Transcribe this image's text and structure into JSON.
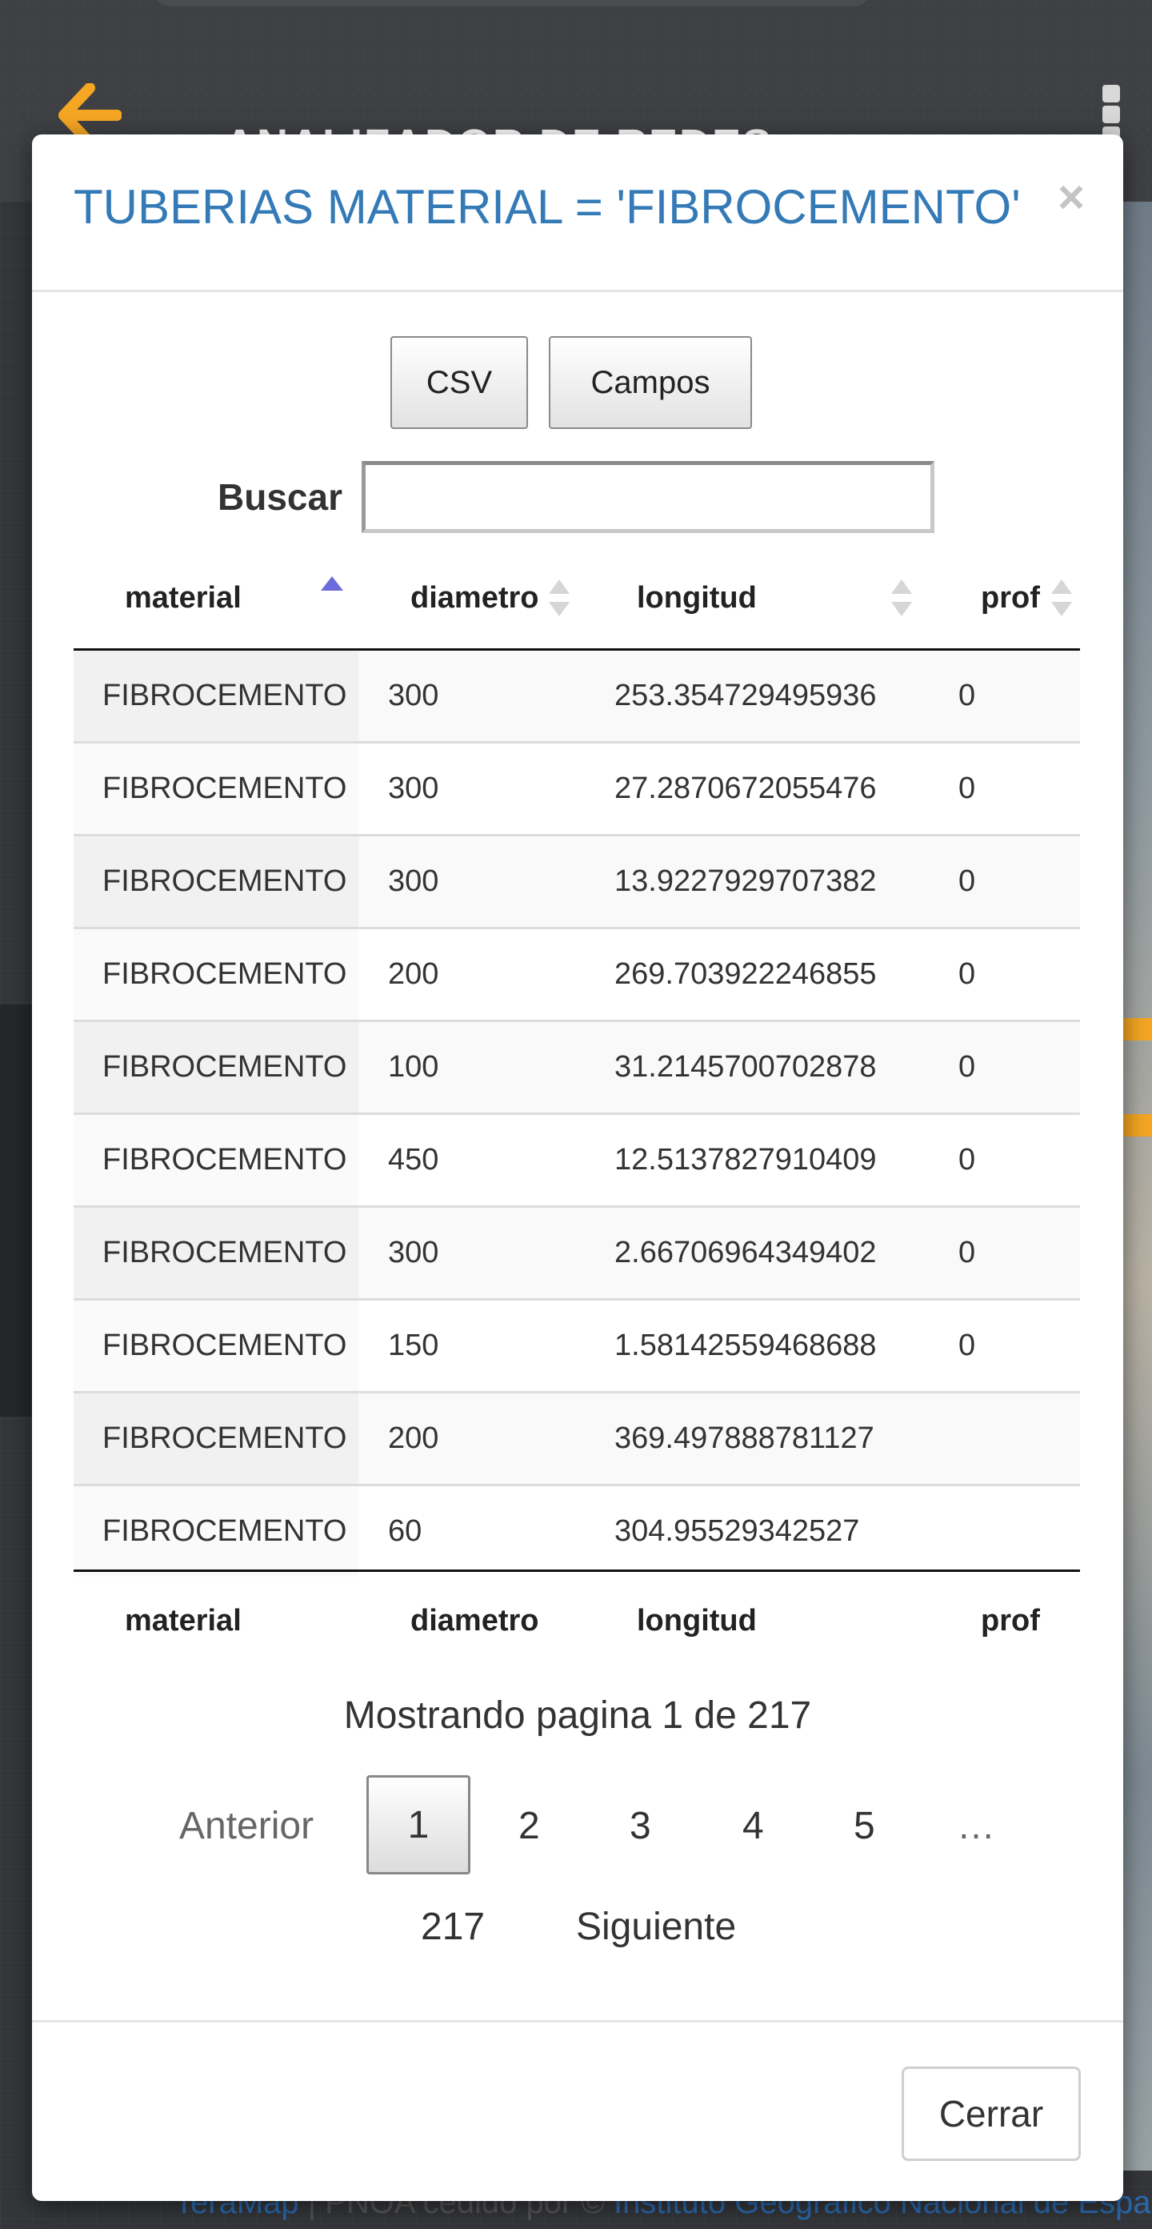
{
  "app": {
    "title": "ANALIZADOR DE REDES",
    "attribution": {
      "link1": "TeraMap",
      "middle": " | PNOA cedido por © ",
      "link2": "Instituto Geográfico Nacional de España"
    }
  },
  "modal": {
    "title": "TUBERIAS MATERIAL = 'FIBROCEMENTO'",
    "close_glyph": "×",
    "buttons": {
      "csv": "CSV",
      "campos": "Campos"
    },
    "search": {
      "label": "Buscar",
      "value": "",
      "placeholder": ""
    },
    "table": {
      "columns": [
        "material",
        "diametro",
        "longitud",
        "prof"
      ],
      "sorted_column": "material",
      "sort_direction": "ascending",
      "rows": [
        [
          "FIBROCEMENTO",
          "300",
          "253.354729495936",
          "0"
        ],
        [
          "FIBROCEMENTO",
          "300",
          "27.2870672055476",
          "0"
        ],
        [
          "FIBROCEMENTO",
          "300",
          "13.9227929707382",
          "0"
        ],
        [
          "FIBROCEMENTO",
          "200",
          "269.703922246855",
          "0"
        ],
        [
          "FIBROCEMENTO",
          "100",
          "31.2145700702878",
          "0"
        ],
        [
          "FIBROCEMENTO",
          "450",
          "12.5137827910409",
          "0"
        ],
        [
          "FIBROCEMENTO",
          "300",
          "2.66706964349402",
          "0"
        ],
        [
          "FIBROCEMENTO",
          "150",
          "1.58142559468688",
          "0"
        ],
        [
          "FIBROCEMENTO",
          "200",
          "369.497888781127",
          ""
        ],
        [
          "FIBROCEMENTO",
          "60",
          "304.95529342527",
          ""
        ]
      ]
    },
    "pagination": {
      "info": "Mostrando pagina 1 de 217",
      "previous": "Anterior",
      "current": "1",
      "pages": [
        "2",
        "3",
        "4",
        "5"
      ],
      "ellipsis": "…",
      "last": "217",
      "next": "Siguiente"
    },
    "footer": {
      "close_label": "Cerrar"
    }
  },
  "colors": {
    "title": "#337ab7",
    "back_arrow": "#f5a623",
    "sort_active": "#6b6bdb",
    "sort_inactive": "#d6d6d6"
  }
}
